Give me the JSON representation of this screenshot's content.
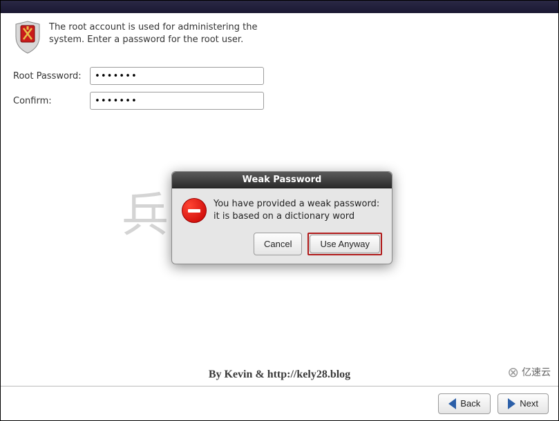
{
  "header": {
    "instruction": "The root account is used for administering the system.  Enter a password for the root user."
  },
  "form": {
    "password_label": "Root Password:",
    "password_value": "•••••••",
    "confirm_label": "Confirm:",
    "confirm_value": "•••••••"
  },
  "dialog": {
    "title": "Weak Password",
    "message": "You have provided a weak password: it is based on a dictionary word",
    "cancel_label": "Cancel",
    "confirm_label": "Use Anyway"
  },
  "footer": {
    "caption": "By Kevin & http://kely28.blog",
    "back_label": "Back",
    "next_label": "Next"
  },
  "watermark": {
    "text": "兵马俑复苏",
    "corner": "亿速云"
  }
}
